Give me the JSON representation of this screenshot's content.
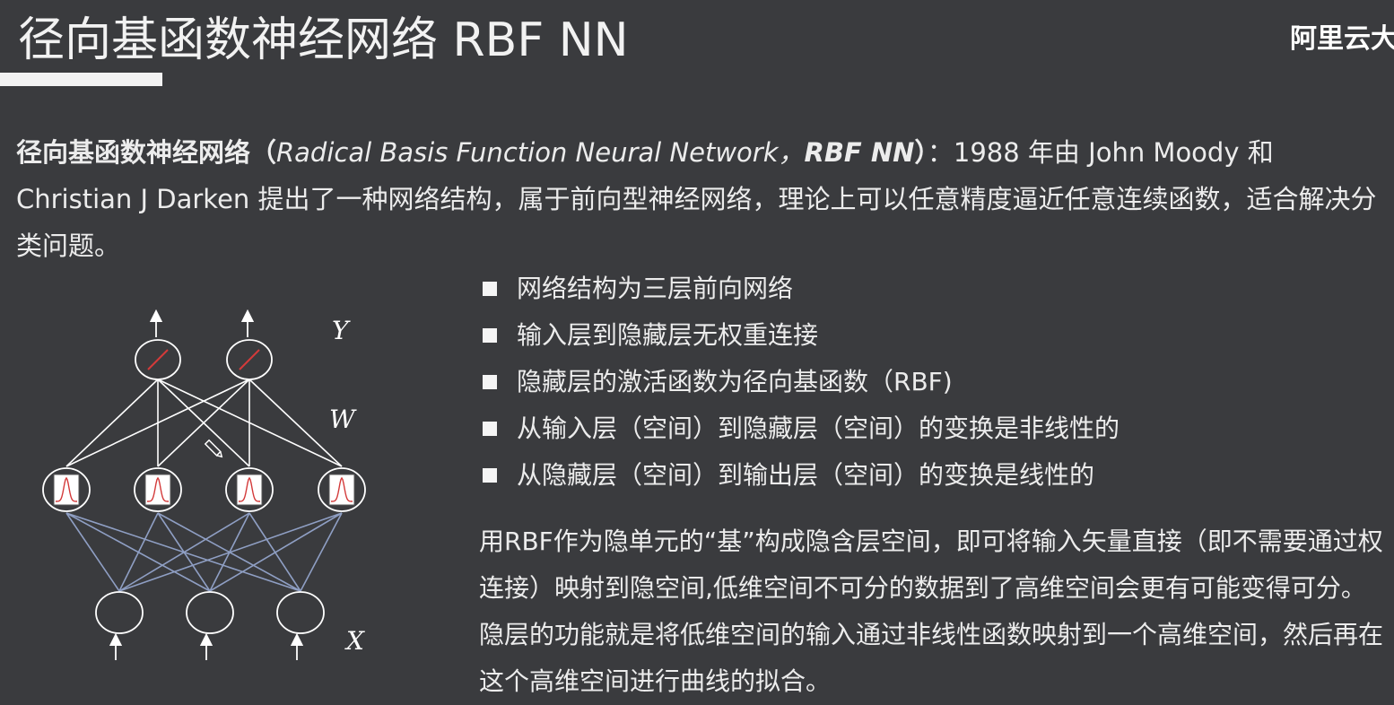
{
  "header": {
    "title": "径向基函数神经网络 RBF NN",
    "brand": "阿里云大"
  },
  "intro": {
    "term_cn": "径向基函数神经网络（",
    "term_en": "Radical Basis Function Neural Network，",
    "term_abbr": "RBF NN",
    "term_close": "）",
    "rest": "：1988 年由 John Moody 和 Christian J Darken 提出了一种网络结构，属于前向型神经网络，理论上可以任意精度逼近任意连续函数，适合解决分类问题。"
  },
  "bullets": [
    "网络结构为三层前向网络",
    "输入层到隐藏层无权重连接",
    "隐藏层的激活函数为径向基函数（RBF)",
    "从输入层（空间）到隐藏层（空间）的变换是非线性的",
    "从隐藏层（空间）到输出层（空间）的变换是线性的"
  ],
  "paragraph": "用RBF作为隐单元的“基”构成隐含层空间，即可将输入矢量直接（即不需要通过权连接）映射到隐空间,低维空间不可分的数据到了高维空间会更有可能变得可分。隐层的功能就是将低维空间的输入通过非线性函数映射到一个高维空间，然后再在这个高维空间进行曲线的拟合。",
  "diagram": {
    "label_output": "Y",
    "label_weights": "W",
    "label_input": "X",
    "input_edge_color": "#8f9fc4",
    "output_edge_color": "#ffffff",
    "linear_mark_color": "#d33a3a"
  }
}
